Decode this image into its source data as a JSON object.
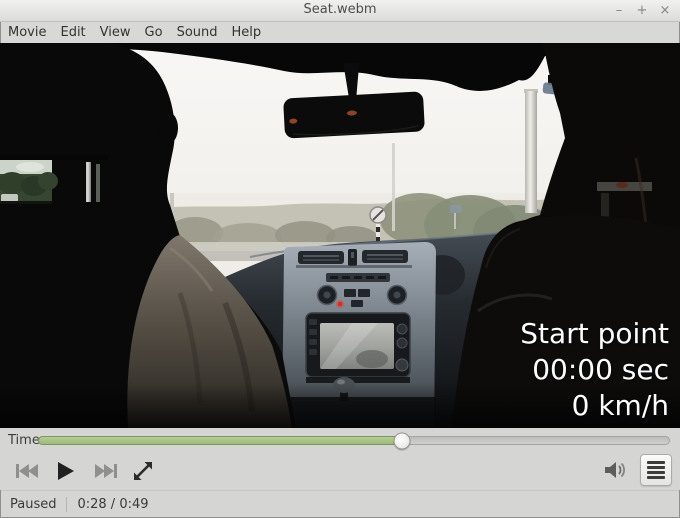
{
  "window": {
    "title": "Seat.webm",
    "minimize_glyph": "–",
    "maximize_glyph": "+",
    "close_glyph": "×"
  },
  "menubar": {
    "items": [
      "Movie",
      "Edit",
      "View",
      "Go",
      "Sound",
      "Help"
    ]
  },
  "video": {
    "overlay": {
      "line1": "Start point",
      "line2": "00:00 sec",
      "line3": "0 km/h"
    }
  },
  "controls": {
    "time_label": "Time:",
    "progress_percent": 57.6,
    "icons": {
      "previous": "skip-backward",
      "play": "play-triangle",
      "next": "skip-forward",
      "fullscreen": "expand-diagonal-arrows",
      "volume": "speaker-with-waves",
      "menu": "hamburger-lines"
    }
  },
  "statusbar": {
    "state": "Paused",
    "position": "0:28 / 0:49"
  },
  "colors": {
    "accent_green_fill": "#a8c18a",
    "accent_green_border": "#7f955f",
    "chrome_background": "#d5d5d3",
    "titlebar_top": "#f1f1f0"
  }
}
